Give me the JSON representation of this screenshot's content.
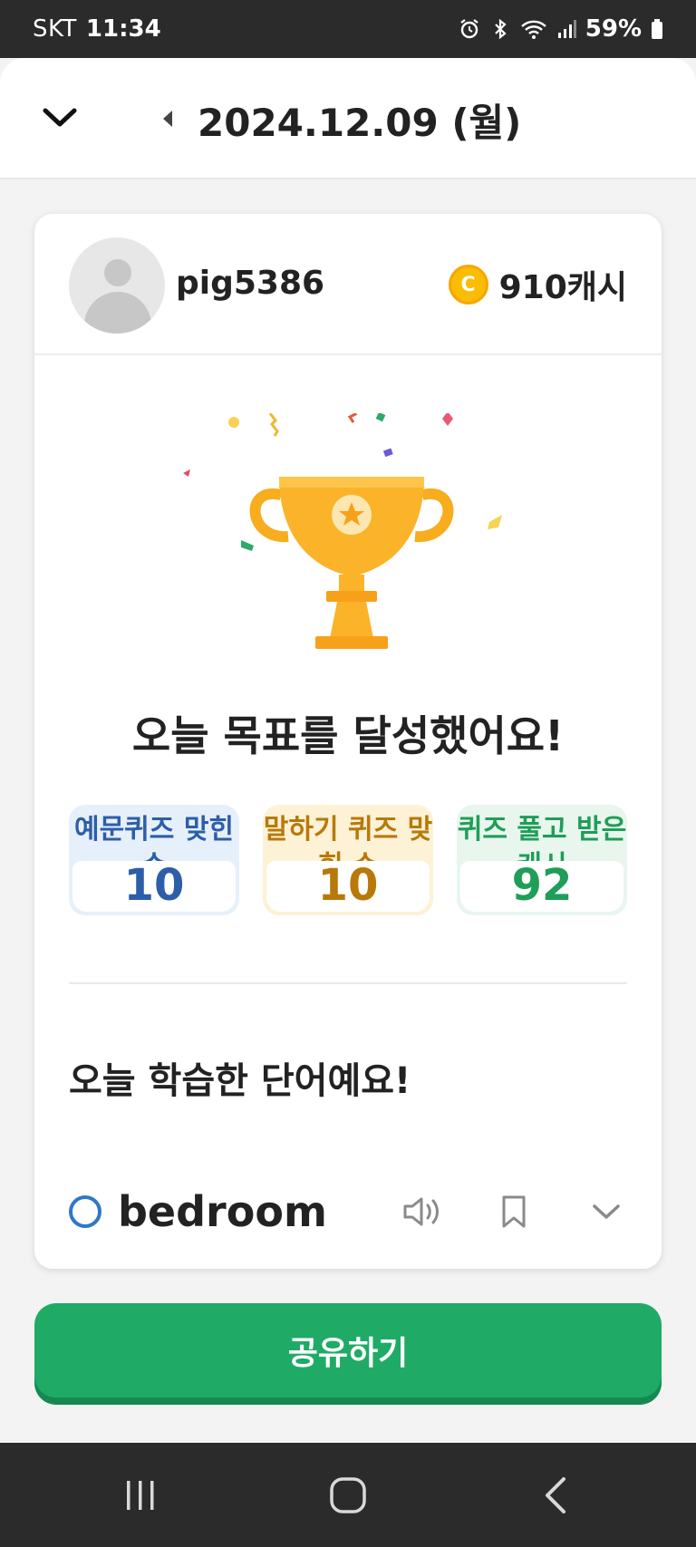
{
  "status_bar": {
    "carrier": "SKT",
    "time": "11:34",
    "battery": "59%",
    "icons": [
      "alarm-icon",
      "bluetooth-icon",
      "wifi-icon",
      "signal-icon",
      "battery-icon"
    ]
  },
  "header": {
    "date": "2024.12.09 (월)",
    "icons": [
      "chevron-down-icon",
      "caret-left-icon"
    ]
  },
  "profile": {
    "username": "pig5386",
    "cash": "910캐시",
    "coin_symbol": "C"
  },
  "goal": {
    "title": "오늘 목표를 달성했어요!"
  },
  "stats": [
    {
      "label": "예문퀴즈 맞힌 수",
      "value": "10",
      "color": "#2d5ea8"
    },
    {
      "label": "말하기 퀴즈 맞힌 수",
      "value": "10",
      "color": "#b8790a"
    },
    {
      "label": "퀴즈 풀고 받은 캐시",
      "value": "92",
      "color": "#1f9e58"
    }
  ],
  "words": {
    "title": "오늘 학습한 단어예요!",
    "items": [
      {
        "word": "bedroom",
        "icons": [
          "speaker-icon",
          "bookmark-icon",
          "chevron-down-icon"
        ]
      }
    ]
  },
  "share_button": {
    "label": "공유하기",
    "color": "#1fab66"
  },
  "nav_bar": {
    "icons": [
      "recents-icon",
      "home-icon",
      "back-icon"
    ]
  }
}
